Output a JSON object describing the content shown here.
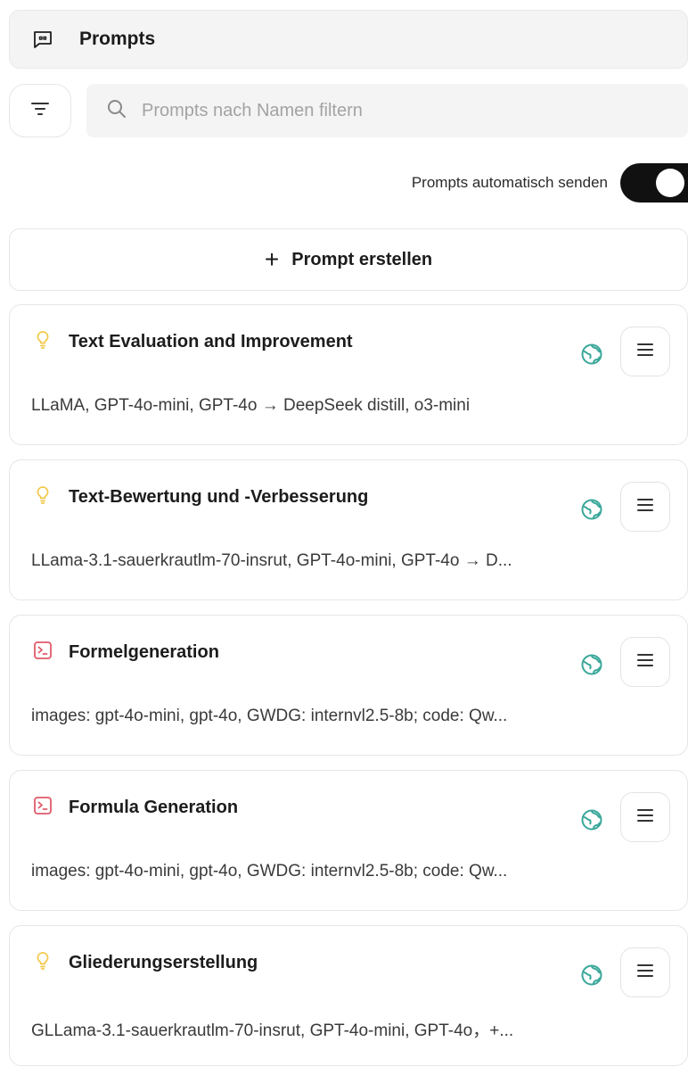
{
  "header": {
    "title": "Prompts",
    "icon": "chat-quote-icon"
  },
  "search": {
    "placeholder": "Prompts nach Namen filtern"
  },
  "auto_send": {
    "label": "Prompts automatisch senden",
    "enabled": true
  },
  "create": {
    "label": "Prompt erstellen"
  },
  "colors": {
    "accent_teal": "#3aa79a",
    "bulb_yellow": "#f2c94c",
    "formula_red": "#e05a6a"
  },
  "cards": [
    {
      "title": "Text Evaluation and Improvement",
      "desc": "LLaMA, GPT-4o-mini, GPT-4o → DeepSeek distill, o3-mini",
      "type_icon": "lightbulb-icon"
    },
    {
      "title": "Text-Bewertung und -Verbesserung",
      "desc": "LLama-3.1-sauerkrautlm-70-insrut, GPT-4o-mini, GPT-4o → D...",
      "type_icon": "lightbulb-icon"
    },
    {
      "title": "Formelgeneration",
      "desc": "images: gpt-4o-mini, gpt-4o, GWDG: internvl2.5-8b; code: Qw...",
      "type_icon": "terminal-icon"
    },
    {
      "title": "Formula Generation",
      "desc": "images: gpt-4o-mini, gpt-4o, GWDG: internvl2.5-8b; code: Qw...",
      "type_icon": "terminal-icon"
    },
    {
      "title": "Gliederungserstellung",
      "desc": "GLLama-3.1-sauerkrautlm-70-insrut, GPT-4o-mini, GPT-4o，+...",
      "type_icon": "lightbulb-icon"
    }
  ]
}
